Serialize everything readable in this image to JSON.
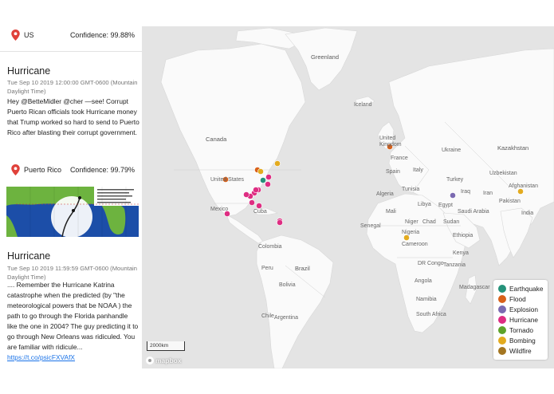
{
  "sidebar": {
    "top_location": {
      "name": "US",
      "confidence": "Confidence: 99.88%"
    },
    "posts": [
      {
        "title": "Hurricane",
        "time": "Tue Sep 10 2019 12:00:00 GMT-0600 (Mountain Daylight Time)",
        "body": "Hey @BetteMidler @cher —see! Corrupt Puerto Rican officials took Hurricane money that Trump worked so hard to send to Puerto Rico after blasting their corrupt government.",
        "location": "Puerto Rico",
        "confidence": "Confidence: 99.79%"
      },
      {
        "title": "Hurricane",
        "time": "Tue Sep 10 2019 11:59:59 GMT-0600 (Mountain Daylight Time)",
        "body": ".... Remember the Hurricane Katrina catastrophe when the predicted (by \"the meteorological powers that be NOAA ) the path to go through the Florida panhandle like the one in 2004? The guy predicting it to go through New Orleans was ridiculed. You are familiar with ridicule...",
        "link": "https://t.co/psicFXVAfX"
      }
    ]
  },
  "map": {
    "labels": {
      "greenland": "Greenland",
      "iceland": "Iceland",
      "canada": "Canada",
      "united_kingdom": "United Kingdom",
      "france": "France",
      "ukraine": "Ukraine",
      "kazakhstan": "Kazakhstan",
      "united_states": "United States",
      "spain": "Spain",
      "italy": "Italy",
      "turkey": "Turkey",
      "uzbekistan": "Uzbekistan",
      "tunisia": "Tunisia",
      "iraq": "Iraq",
      "iran": "Iran",
      "afghanistan": "Afghanistan",
      "mexico": "Mexico",
      "cuba": "Cuba",
      "algeria": "Algeria",
      "libya": "Libya",
      "egypt": "Egypt",
      "saudi_arabia": "Saudi Arabia",
      "pakistan": "Pakistan",
      "india": "India",
      "mali": "Mali",
      "niger": "Niger",
      "chad": "Chad",
      "sudan": "Sudan",
      "senegal": "Senegal",
      "nigeria": "Nigeria",
      "ethiopia": "Ethiopia",
      "colombia": "Colombia",
      "cameroon": "Cameroon",
      "kenya": "Kenya",
      "dr_congo": "DR Congo",
      "tanzania": "Tanzania",
      "peru": "Peru",
      "brazil": "Brazil",
      "angola": "Angola",
      "bolivia": "Bolivia",
      "namibia": "Namibia",
      "madagascar": "Madagascar",
      "south_africa": "South Africa",
      "chile": "Chile",
      "argentina": "Argentina"
    },
    "scale_label": "2000km",
    "attribution": "mapbox",
    "colors": {
      "land": "#fafafa",
      "water": "#e4e4e4"
    }
  },
  "legend": [
    {
      "label": "Earthquake",
      "color": "#25927a"
    },
    {
      "label": "Flood",
      "color": "#d9611a"
    },
    {
      "label": "Explosion",
      "color": "#7b6ab1"
    },
    {
      "label": "Hurricane",
      "color": "#de2d82"
    },
    {
      "label": "Tornado",
      "color": "#5ea32a"
    },
    {
      "label": "Bombing",
      "color": "#e3ab1f"
    },
    {
      "label": "Wildfire",
      "color": "#a47621"
    }
  ],
  "markers": [
    {
      "type": "Flood",
      "place": "United States"
    },
    {
      "type": "Flood",
      "place": "Great Lakes"
    },
    {
      "type": "Bombing",
      "place": "Great Lakes"
    },
    {
      "type": "Bombing",
      "place": "New England"
    },
    {
      "type": "Earthquake",
      "place": "Eastern US"
    },
    {
      "type": "Hurricane",
      "place": "Eastern US"
    },
    {
      "type": "Hurricane",
      "place": "Eastern US"
    },
    {
      "type": "Hurricane",
      "place": "Southeastern US"
    },
    {
      "type": "Hurricane",
      "place": "Southeastern US"
    },
    {
      "type": "Hurricane",
      "place": "Gulf Coast"
    },
    {
      "type": "Hurricane",
      "place": "Gulf Coast"
    },
    {
      "type": "Hurricane",
      "place": "Texas"
    },
    {
      "type": "Hurricane",
      "place": "Florida"
    },
    {
      "type": "Hurricane",
      "place": "Florida"
    },
    {
      "type": "Hurricane",
      "place": "Mexico"
    },
    {
      "type": "Hurricane",
      "place": "Cuba"
    },
    {
      "type": "Hurricane",
      "place": "Puerto Rico"
    },
    {
      "type": "Flood",
      "place": "United Kingdom"
    },
    {
      "type": "Explosion",
      "place": "Egypt"
    },
    {
      "type": "Bombing",
      "place": "Pakistan"
    },
    {
      "type": "Bombing",
      "place": "Nigeria"
    }
  ]
}
